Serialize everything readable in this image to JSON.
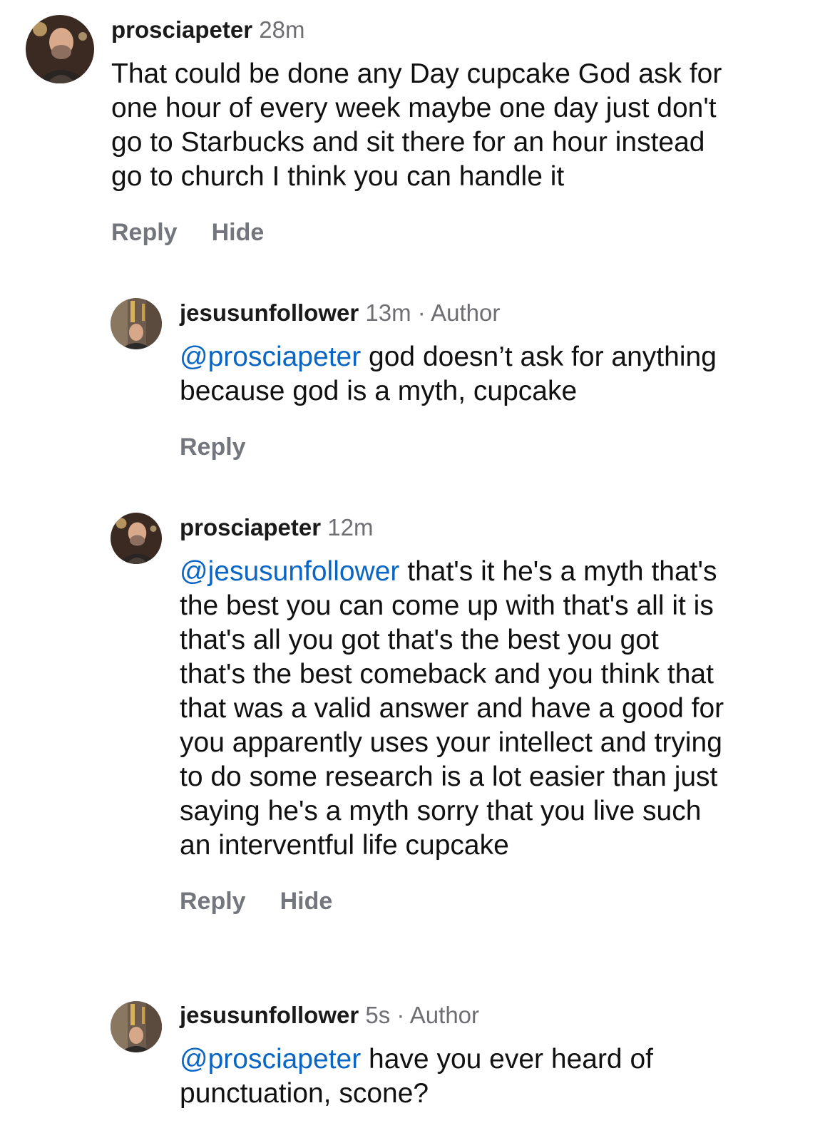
{
  "comments": [
    {
      "username": "prosciapeter",
      "time": "28m",
      "author_label": "",
      "mention": "",
      "text": "That could be done any Day cupcake God ask for\none hour of every week maybe one day just don't\ngo to Starbucks and sit there for an hour instead\ngo to church I think you can handle it",
      "actions": [
        "Reply",
        "Hide"
      ],
      "avatar_icon": "bearded-man-avatar"
    },
    {
      "username": "jesusunfollower",
      "time": "13m",
      "separator": "·",
      "author_label": "Author",
      "mention": "@prosciapeter",
      "text": " god doesn’t ask for anything\nbecause god is a myth, cupcake",
      "actions": [
        "Reply"
      ],
      "avatar_icon": "street-selfie-avatar"
    },
    {
      "username": "prosciapeter",
      "time": "12m",
      "author_label": "",
      "mention": "@jesusunfollower",
      "text": " that's it he's a myth that's\nthe best you can come up with that's all it is\nthat's all you got that's the best you got\nthat's the best comeback and you think that\nthat was a valid answer and have a good for\nyou apparently uses your intellect and trying\nto do some research is a lot easier than just\nsaying he's a myth sorry that you live such\nan interventful life cupcake",
      "actions": [
        "Reply",
        "Hide"
      ],
      "avatar_icon": "bearded-man-avatar"
    },
    {
      "username": "jesusunfollower",
      "time": "5s",
      "separator": "·",
      "author_label": "Author",
      "mention": "@prosciapeter",
      "text": " have you ever heard of\npunctuation, scone?",
      "actions": [],
      "avatar_icon": "street-selfie-avatar"
    }
  ],
  "colors": {
    "mention": "#0a66c2",
    "meta_gray": "#6e6e73",
    "action_gray": "#73767d"
  }
}
